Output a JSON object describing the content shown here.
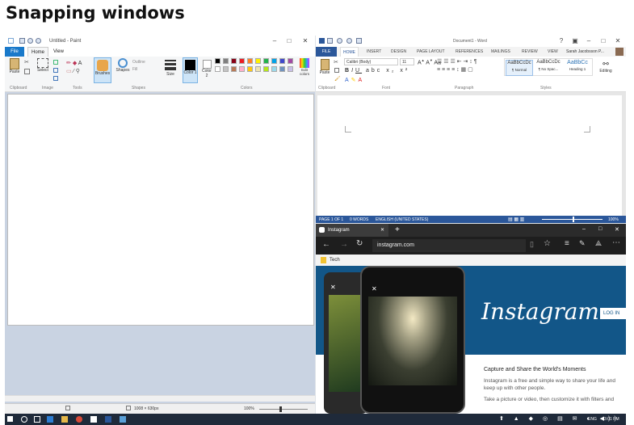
{
  "heading": "Snapping windows",
  "paint": {
    "title": "Untitled - Paint",
    "tabs": {
      "file": "File",
      "home": "Home",
      "view": "View"
    },
    "ribbon": {
      "paste": "Paste",
      "select": "Select",
      "brushes": "Brushes",
      "shapes": "Shapes",
      "outline": "Outline",
      "fill": "Fill",
      "size": "Size",
      "color1": "Color 1",
      "color2": "Color 2",
      "edit_colors": "Edit colors"
    },
    "groups": {
      "clipboard": "Clipboard",
      "image": "Image",
      "tools": "Tools",
      "shapes": "Shapes",
      "colors": "Colors"
    },
    "palette": [
      "#000000",
      "#7f7f7f",
      "#880015",
      "#ed1c24",
      "#ff7f27",
      "#fff200",
      "#22b14c",
      "#00a2e8",
      "#3f48cc",
      "#a349a4",
      "#ffffff",
      "#c3c3c3",
      "#b97a57",
      "#ffaec9",
      "#ffc90e",
      "#efe4b0",
      "#b5e61d",
      "#99d9ea",
      "#7092be",
      "#c8bfe7"
    ],
    "status": {
      "dimensions": "1008 × 630px",
      "zoom": "100%"
    }
  },
  "word": {
    "title": "Document1 - Word",
    "user": "Sarah Jacobsson P...",
    "tabs": {
      "file": "FILE",
      "home": "HOME",
      "insert": "INSERT",
      "design": "DESIGN",
      "page_layout": "PAGE LAYOUT",
      "references": "REFERENCES",
      "mailings": "MAILINGS",
      "review": "REVIEW",
      "view": "VIEW"
    },
    "font": "Calibri (Body)",
    "font_size": "11",
    "styles": [
      {
        "preview": "AaBbCcDc",
        "name": "¶ Normal"
      },
      {
        "preview": "AaBbCcDc",
        "name": "¶ No Spac..."
      },
      {
        "preview": "AaBbCc",
        "name": "Heading 1"
      }
    ],
    "ribbon": {
      "paste": "Paste",
      "editing": "Editing"
    },
    "groups": {
      "clipboard": "Clipboard",
      "font": "Font",
      "paragraph": "Paragraph",
      "styles": "Styles"
    },
    "status": {
      "page": "PAGE 1 OF 1",
      "words": "0 WORDS",
      "language": "ENGLISH (UNITED STATES)",
      "zoom": "100%"
    }
  },
  "edge": {
    "tab_title": "Instagram",
    "new_tab": "+",
    "url": "instagram.com",
    "favorite": "Tech",
    "brand": "Instagram",
    "login": "LOG IN",
    "headline": "Capture and Share the World's Moments",
    "body1": "Instagram is a free and simple way to share your life and keep up with other people.",
    "body2": "Take a picture or video, then customize it with filters and"
  },
  "taskbar": {
    "language": "ENG",
    "time": "3:01 PM"
  }
}
